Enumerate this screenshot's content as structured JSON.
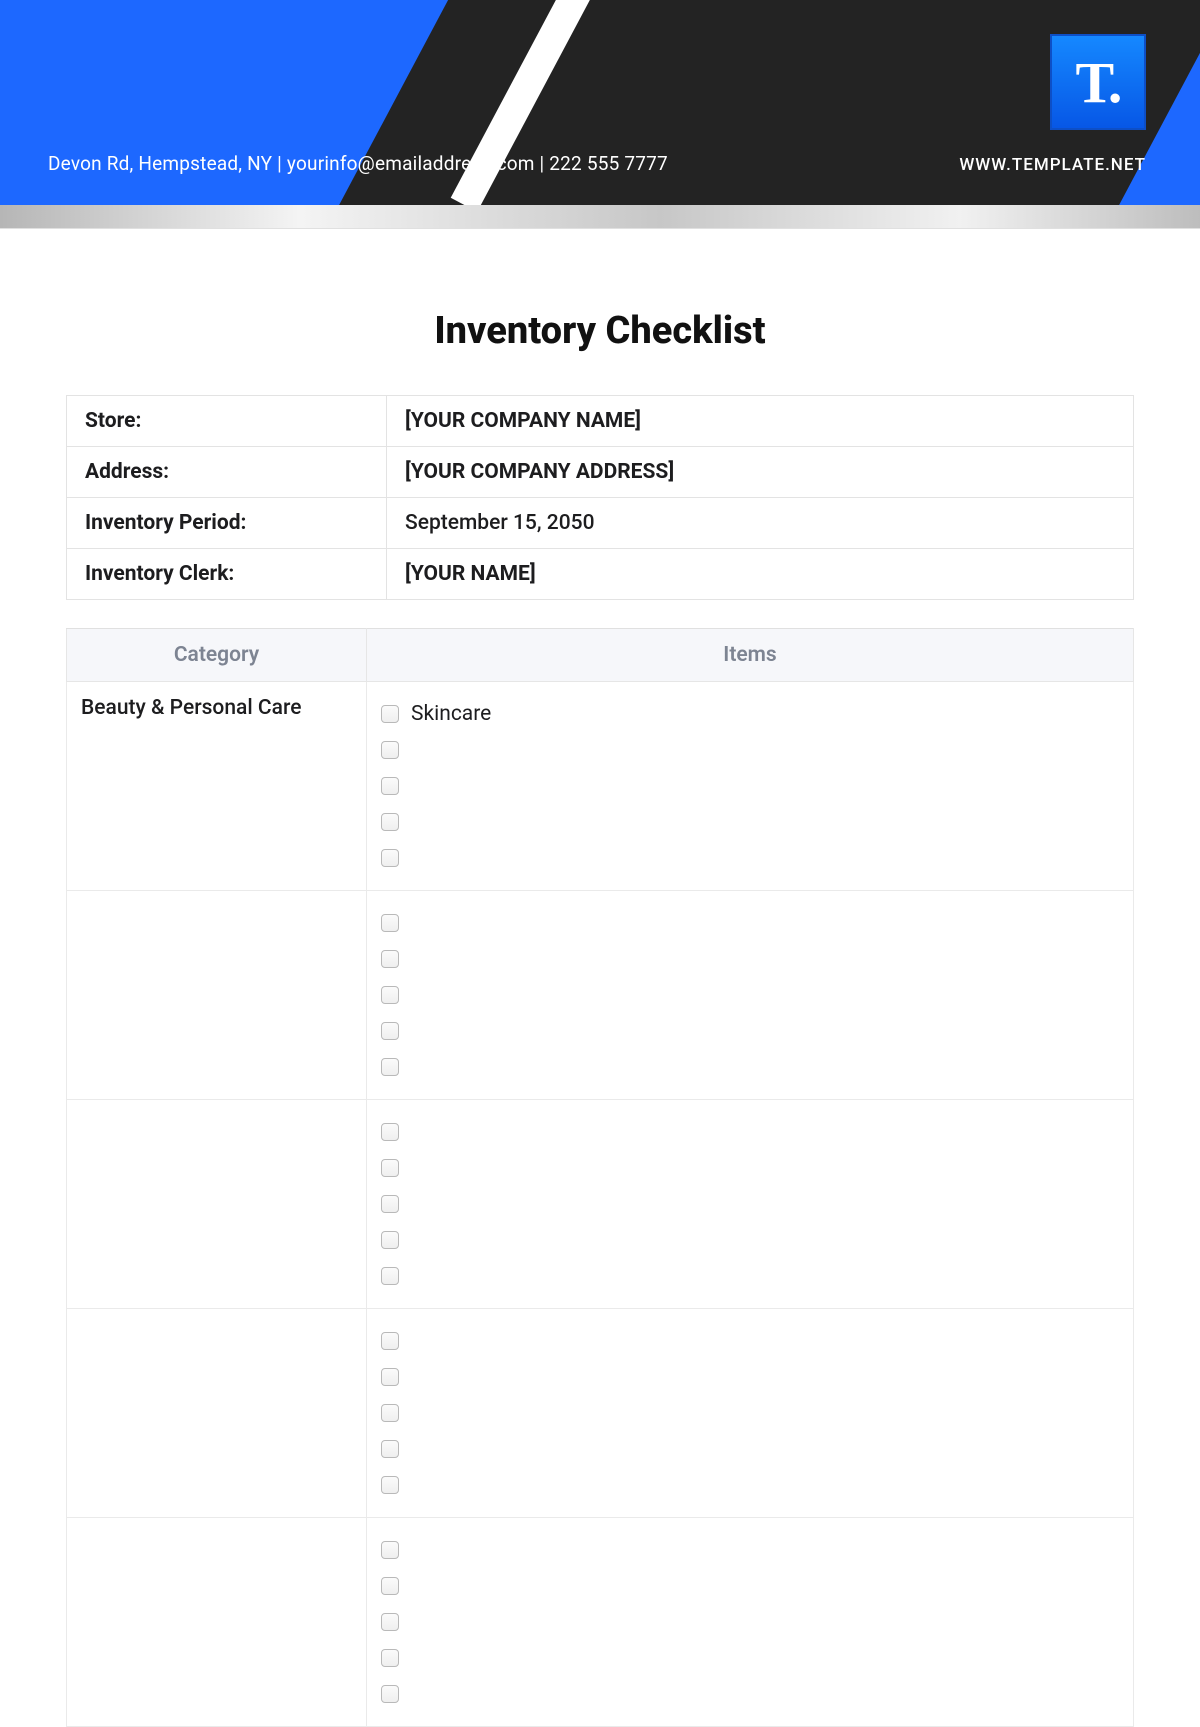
{
  "header": {
    "contact": "Devon Rd, Hempstead, NY | yourinfo@emailaddress.com | 222 555 7777",
    "logo_letter": "T.",
    "website": "WWW.TEMPLATE.NET"
  },
  "title": "Inventory Checklist",
  "info": {
    "store_label": "Store:",
    "store_value": "[YOUR COMPANY NAME]",
    "address_label": "Address:",
    "address_value": "[YOUR COMPANY ADDRESS]",
    "period_label": "Inventory Period:",
    "period_value": "September 15, 2050",
    "clerk_label": "Inventory Clerk:",
    "clerk_value": "[YOUR NAME]"
  },
  "columns": {
    "category": "Category",
    "items": "Items"
  },
  "rows": [
    {
      "category": "Beauty & Personal Care",
      "items": [
        "Skincare",
        "",
        "",
        "",
        ""
      ]
    },
    {
      "category": "",
      "items": [
        "",
        "",
        "",
        "",
        ""
      ]
    },
    {
      "category": "",
      "items": [
        "",
        "",
        "",
        "",
        ""
      ]
    },
    {
      "category": "",
      "items": [
        "",
        "",
        "",
        "",
        ""
      ]
    },
    {
      "category": "",
      "items": [
        "",
        "",
        "",
        "",
        ""
      ]
    }
  ]
}
